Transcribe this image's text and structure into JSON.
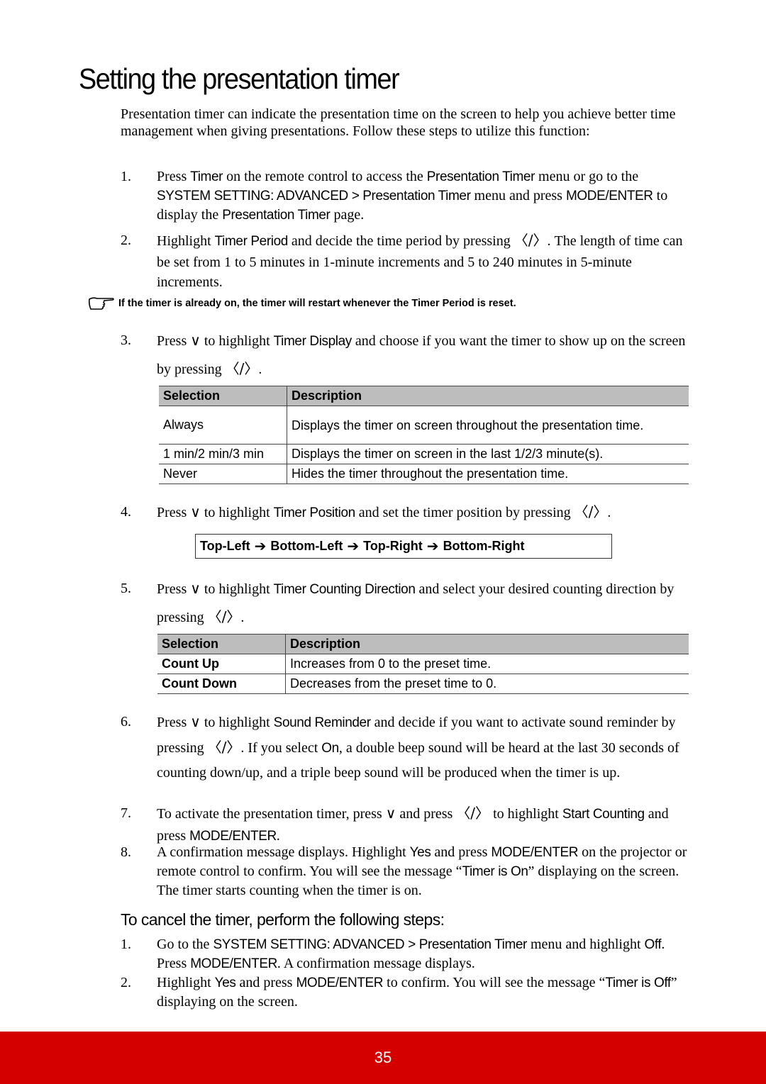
{
  "page": {
    "title": "Setting the presentation timer",
    "intro": "Presentation timer can indicate the presentation time on the screen to help you achieve better time management when giving presentations. Follow these steps to utilize this function:",
    "page_number": "35",
    "accent_color": "#d40000"
  },
  "icons": {
    "down": "∨",
    "left_right": "〈/〉",
    "arrow": "➔"
  },
  "steps": [
    {
      "num": "1.",
      "parts": [
        {
          "t": "Press "
        },
        {
          "u": "Timer"
        },
        {
          "t": " on the remote control to access the "
        },
        {
          "u": "Presentation Timer"
        },
        {
          "t": " menu or go to the "
        },
        {
          "u": "SYSTEM SETTING: ADVANCED > Presentation Timer"
        },
        {
          "t": " menu and press "
        },
        {
          "u": "MODE/ENTER"
        },
        {
          "t": " to display the "
        },
        {
          "u": "Presentation Timer"
        },
        {
          "t": " page."
        }
      ]
    },
    {
      "num": "2.",
      "parts": [
        {
          "t": "Highlight "
        },
        {
          "u": "Timer Period"
        },
        {
          "t": " and decide the time period by pressing "
        },
        {
          "i": "left_right"
        },
        {
          "t": ". The length of time can be set from 1 to 5 minutes in 1-minute increments and 5 to 240 minutes in 5-minute increments."
        }
      ]
    },
    {
      "num": "3.",
      "parts": [
        {
          "t": "Press "
        },
        {
          "i": "down"
        },
        {
          "t": " to highlight "
        },
        {
          "u": "Timer Display"
        },
        {
          "t": " and choose if you want the timer to show up on the screen by pressing "
        },
        {
          "i": "left_right"
        },
        {
          "t": "."
        }
      ]
    },
    {
      "num": "4.",
      "parts": [
        {
          "t": "Press "
        },
        {
          "i": "down"
        },
        {
          "t": " to highlight "
        },
        {
          "u": "Timer Position"
        },
        {
          "t": " and set the timer position by pressing "
        },
        {
          "i": "left_right"
        },
        {
          "t": "."
        }
      ]
    },
    {
      "num": "5.",
      "parts": [
        {
          "t": "Press "
        },
        {
          "i": "down"
        },
        {
          "t": " to highlight "
        },
        {
          "u": "Timer Counting Direction"
        },
        {
          "t": " and select your desired counting direction by pressing "
        },
        {
          "i": "left_right"
        },
        {
          "t": "."
        }
      ]
    },
    {
      "num": "6.",
      "parts": [
        {
          "t": "Press "
        },
        {
          "i": "down"
        },
        {
          "t": " to highlight "
        },
        {
          "u": "Sound Reminder"
        },
        {
          "t": " and decide if you want to activate sound reminder by pressing "
        },
        {
          "i": "left_right"
        },
        {
          "t": ". If you select "
        },
        {
          "u": "On"
        },
        {
          "t": ", a double beep sound will be heard at the last 30 seconds of counting down/up, and a triple beep sound will be produced when the timer is up."
        }
      ]
    },
    {
      "num": "7.",
      "parts": [
        {
          "t": "To activate the presentation timer, press "
        },
        {
          "i": "down"
        },
        {
          "t": " and press "
        },
        {
          "i": "left_right"
        },
        {
          "t": " to highlight "
        },
        {
          "u": "Start Counting"
        },
        {
          "t": " and press "
        },
        {
          "u": "MODE/ENTER"
        },
        {
          "t": "."
        }
      ]
    },
    {
      "num": "8.",
      "parts": [
        {
          "t": "A confirmation message displays. Highlight "
        },
        {
          "u": "Yes"
        },
        {
          "t": " and press "
        },
        {
          "u": "MODE/ENTER"
        },
        {
          "t": " on the projector or remote control to confirm. You will see the message “"
        },
        {
          "u": "Timer is On"
        },
        {
          "t": "” displaying on the screen. The timer starts counting when the timer is on."
        }
      ]
    }
  ],
  "note": "If the timer is already on, the timer will restart whenever the Timer Period is reset.",
  "display_table": {
    "headers": [
      "Selection",
      "Description"
    ],
    "rows": [
      [
        "Always",
        "Displays the timer on screen throughout the presentation time."
      ],
      [
        "1 min/2 min/3 min",
        "Displays the timer on screen in the last 1/2/3 minute(s)."
      ],
      [
        "Never",
        "Hides the timer throughout the presentation time."
      ]
    ]
  },
  "position_sequence": [
    "Top-Left",
    "Bottom-Left",
    "Top-Right",
    "Bottom-Right"
  ],
  "direction_table": {
    "headers": [
      "Selection",
      "Description"
    ],
    "rows": [
      [
        "Count Up",
        "Increases from 0 to the preset time."
      ],
      [
        "Count Down",
        "Decreases from the preset time to 0."
      ]
    ]
  },
  "cancel": {
    "heading": "To cancel the timer, perform the following steps:",
    "steps": [
      {
        "num": "1.",
        "parts": [
          {
            "t": "Go to the "
          },
          {
            "u": "SYSTEM SETTING: ADVANCED > Presentation Timer"
          },
          {
            "t": " menu and highlight "
          },
          {
            "u": "Off"
          },
          {
            "t": ". Press "
          },
          {
            "u": "MODE/ENTER"
          },
          {
            "t": ". A confirmation message displays."
          }
        ]
      },
      {
        "num": "2.",
        "parts": [
          {
            "t": "Highlight "
          },
          {
            "u": "Yes"
          },
          {
            "t": " and press "
          },
          {
            "u": "MODE/ENTER"
          },
          {
            "t": " to confirm. You will see the message “"
          },
          {
            "u": "Timer is Off"
          },
          {
            "t": "” displaying on the screen."
          }
        ]
      }
    ]
  }
}
